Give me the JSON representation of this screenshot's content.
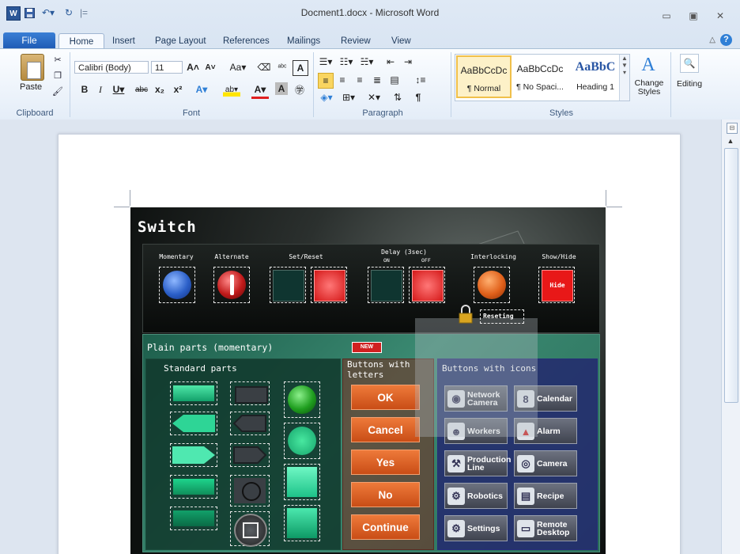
{
  "window": {
    "title": "Docment1.docx - Microsoft Word",
    "quick_access_sep": "|="
  },
  "tabs": {
    "file": "File",
    "home": "Home",
    "insert": "Insert",
    "page_layout": "Page Layout",
    "references": "References",
    "mailings": "Mailings",
    "review": "Review",
    "view": "View"
  },
  "ribbon": {
    "clipboard": {
      "paste": "Paste",
      "label": "Clipboard"
    },
    "font": {
      "name": "Calibri (Body)",
      "size": "11",
      "label": "Font"
    },
    "paragraph": {
      "label": "Paragraph"
    },
    "styles": {
      "items": [
        {
          "sample": "AaBbCcDc",
          "name": "¶ Normal"
        },
        {
          "sample": "AaBbCcDc",
          "name": "¶ No Spaci..."
        },
        {
          "sample": "AaBbC",
          "name": "Heading 1"
        }
      ],
      "change": "Change Styles",
      "label": "Styles"
    },
    "editing": {
      "label": "Editing"
    }
  },
  "hmi": {
    "title": "Switch",
    "switch_labels": [
      "Momentary",
      "Alternate",
      "Set/Reset",
      "Delay (3sec)",
      "Interlocking",
      "Show/Hide"
    ],
    "delay_on": "ON",
    "delay_off": "OFF",
    "hide_button": "Hide",
    "reseting": "Reseting",
    "plain_title": "Plain parts (momentary)",
    "new_badge": "NEW",
    "standard_title": "Standard parts",
    "letters_title": "Buttons with letters",
    "icons_title": "Buttons with icons",
    "letter_buttons": [
      "OK",
      "Cancel",
      "Yes",
      "No",
      "Continue"
    ],
    "icon_buttons": [
      {
        "label": "Network Camera",
        "icon": "camera-icon"
      },
      {
        "label": "Calendar",
        "icon": "calendar-icon"
      },
      {
        "label": "Workers",
        "icon": "workers-icon"
      },
      {
        "label": "Alarm",
        "icon": "alarm-icon"
      },
      {
        "label": "Production Line",
        "icon": "production-line-icon"
      },
      {
        "label": "Camera",
        "icon": "lens-icon"
      },
      {
        "label": "Robotics",
        "icon": "robot-icon"
      },
      {
        "label": "Recipe",
        "icon": "recipe-icon"
      },
      {
        "label": "Settings",
        "icon": "settings-icon"
      },
      {
        "label": "Remote Desktop",
        "icon": "remote-desktop-icon"
      }
    ]
  }
}
